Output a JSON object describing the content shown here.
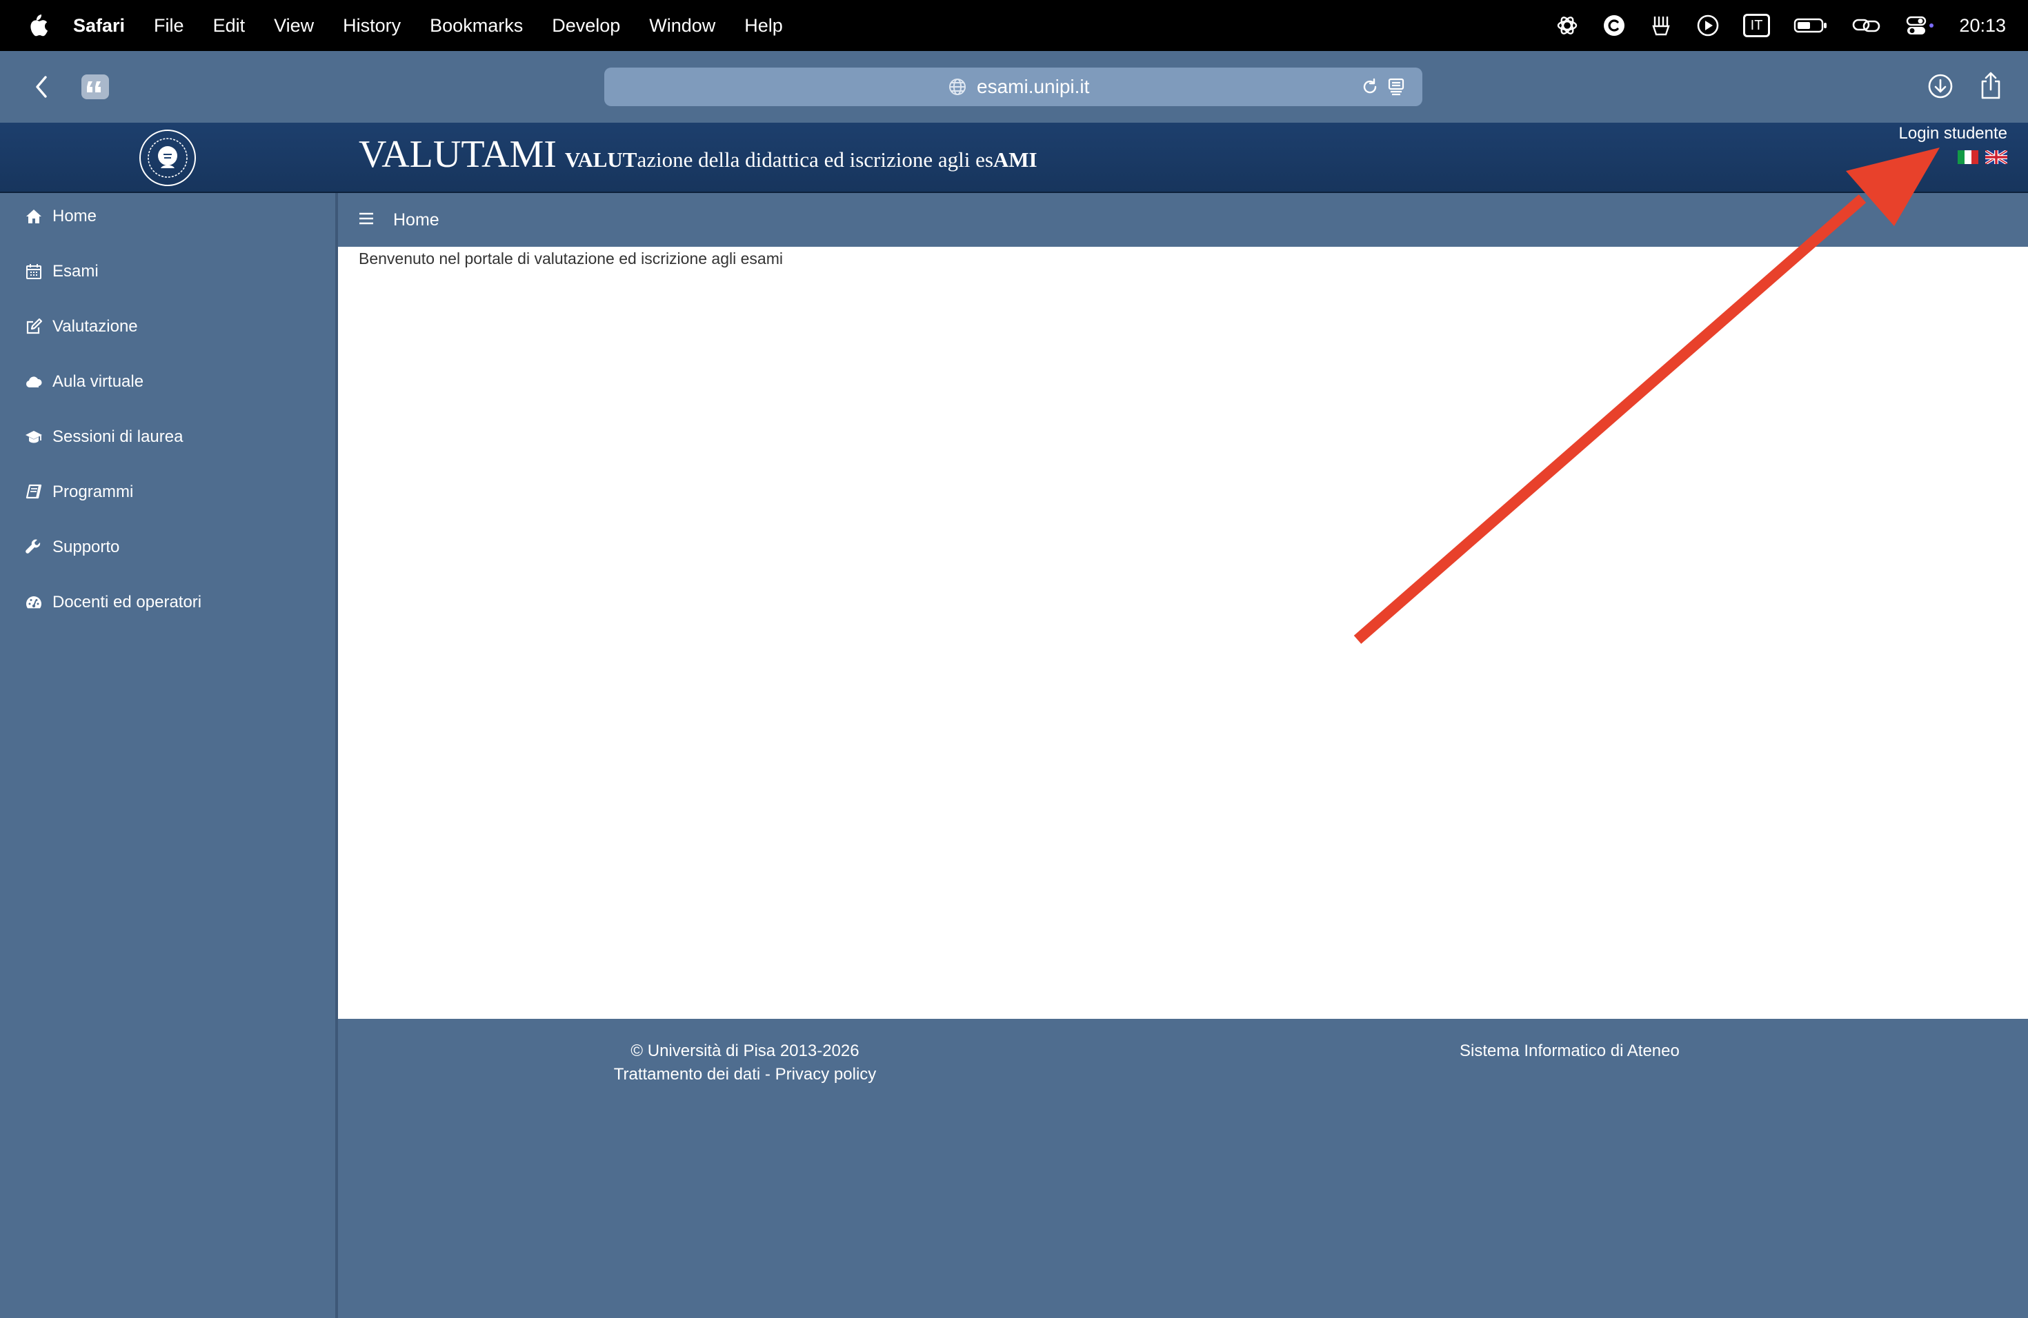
{
  "menubar": {
    "app_name": "Safari",
    "items": [
      "File",
      "Edit",
      "View",
      "History",
      "Bookmarks",
      "Develop",
      "Window",
      "Help"
    ],
    "input_source": "IT",
    "clock": "20:13"
  },
  "browser": {
    "url": "esami.unipi.it"
  },
  "header": {
    "brand_big": "VALUTAMI",
    "tag_1": "VALUT",
    "tag_2": "azione della didattica ed iscrizione agli es",
    "tag_3": "AMI",
    "login_label": "Login studente"
  },
  "sidebar": {
    "items": [
      {
        "label": "Home",
        "icon": "home-icon"
      },
      {
        "label": "Esami",
        "icon": "calendar-icon"
      },
      {
        "label": "Valutazione",
        "icon": "edit-icon"
      },
      {
        "label": "Aula virtuale",
        "icon": "cloud-icon"
      },
      {
        "label": "Sessioni di laurea",
        "icon": "graduation-cap-icon"
      },
      {
        "label": "Programmi",
        "icon": "book-icon"
      },
      {
        "label": "Supporto",
        "icon": "wrench-icon"
      },
      {
        "label": "Docenti ed operatori",
        "icon": "dashboard-icon"
      }
    ]
  },
  "breadcrumb": {
    "current": "Home"
  },
  "main": {
    "welcome": "Benvenuto nel portale di valutazione ed iscrizione agli esami"
  },
  "footer": {
    "copyright": "© Università di Pisa 2013-2026",
    "privacy": "Trattamento dei dati - Privacy policy",
    "system": "Sistema Informatico di Ateneo"
  },
  "colors": {
    "accent_blue": "#4f6d8f",
    "header_navy": "#1d3f6d",
    "annotation_arrow": "#e8412b"
  }
}
